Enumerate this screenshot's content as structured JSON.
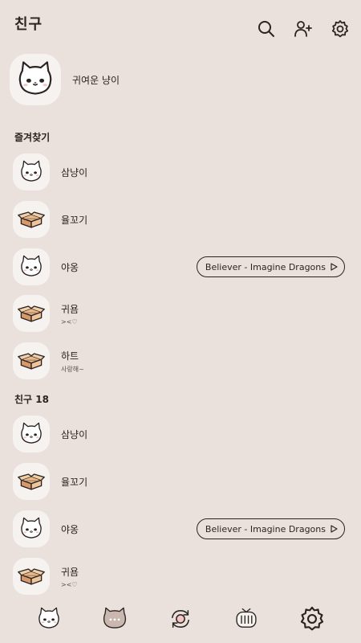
{
  "header": {
    "title": "친구",
    "icons": [
      "search-icon",
      "add-friend-icon",
      "settings-icon"
    ]
  },
  "profile": {
    "name": "귀여운 냥이",
    "avatar": "cat-icon"
  },
  "favorites": {
    "title": "즐겨찾기",
    "items": [
      {
        "name": "삼냥이",
        "status": "",
        "avatar": "cat-icon"
      },
      {
        "name": "율꼬기",
        "status": "",
        "avatar": "box-icon"
      },
      {
        "name": "야옹",
        "status": "",
        "avatar": "cat-icon",
        "music": "Believer - Imagine Dragons"
      },
      {
        "name": "귀욤",
        "status": "><♡",
        "avatar": "box-icon"
      },
      {
        "name": "하트",
        "status": "사랑해~",
        "avatar": "box-icon"
      }
    ]
  },
  "friends": {
    "title": "친구 18",
    "items": [
      {
        "name": "삼냥이",
        "status": "",
        "avatar": "cat-icon"
      },
      {
        "name": "율꼬기",
        "status": "",
        "avatar": "box-icon"
      },
      {
        "name": "야옹",
        "status": "",
        "avatar": "cat-icon",
        "music": "Believer - Imagine Dragons"
      },
      {
        "name": "귀욤",
        "status": "><♡",
        "avatar": "box-icon"
      }
    ]
  },
  "bottom_nav": [
    "friends-tab-cat-icon",
    "chat-tab-icon",
    "refresh-tab-icon",
    "tv-tab-icon",
    "settings-tab-icon"
  ],
  "colors": {
    "background": "#ebe1dc",
    "avatar_bg": "#f6f2ef",
    "text": "#2a2320"
  }
}
